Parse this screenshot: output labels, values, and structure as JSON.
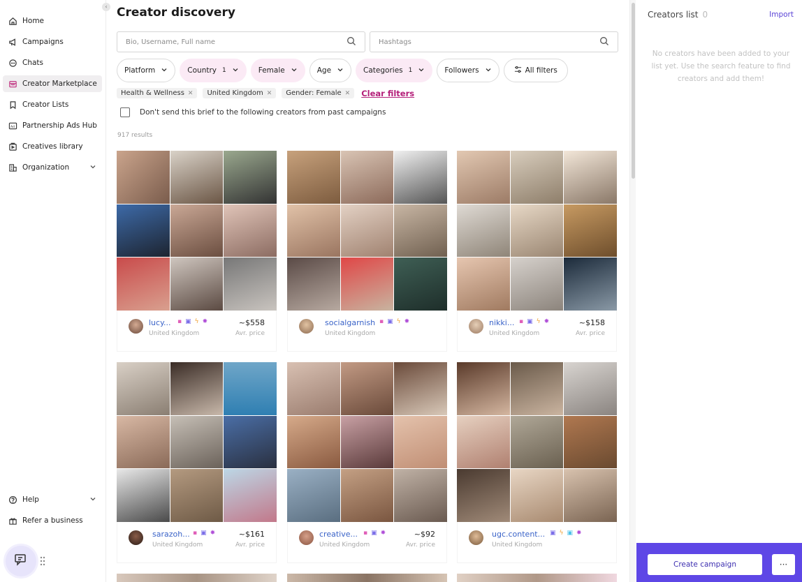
{
  "sidebar": {
    "items": [
      {
        "label": "Home",
        "icon": "home-icon"
      },
      {
        "label": "Campaigns",
        "icon": "megaphone-icon"
      },
      {
        "label": "Chats",
        "icon": "chat-bubble-icon"
      },
      {
        "label": "Creator Marketplace",
        "icon": "marketplace-icon",
        "active": true
      },
      {
        "label": "Creator Lists",
        "icon": "bookmark-icon"
      },
      {
        "label": "Partnership Ads Hub",
        "icon": "ad-icon"
      },
      {
        "label": "Creatives library",
        "icon": "library-icon"
      },
      {
        "label": "Organization",
        "icon": "building-icon",
        "has_chevron": true
      }
    ],
    "bottom": [
      {
        "label": "Help",
        "icon": "help-icon",
        "has_chevron": true
      },
      {
        "label": "Refer a business",
        "icon": "gift-icon"
      }
    ]
  },
  "main": {
    "title": "Creator discovery",
    "search": {
      "placeholder": "Bio, Username, Full name"
    },
    "hashtags": {
      "placeholder": "Hashtags"
    },
    "filters": [
      {
        "label": "Platform",
        "active": false
      },
      {
        "label": "Country",
        "count": "1",
        "active": true
      },
      {
        "label": "Female",
        "active": true
      },
      {
        "label": "Age",
        "active": false
      },
      {
        "label": "Categories",
        "count": "1",
        "active": true
      },
      {
        "label": "Followers",
        "active": false
      }
    ],
    "all_filters": "All filters",
    "chips": [
      "Health & Wellness",
      "United Kingdom",
      "Gender: Female"
    ],
    "clear_filters": "Clear filters",
    "brief_label": "Don't send this brief to the following creators from past campaigns",
    "results": "917 results",
    "price_label": "Avr. price",
    "creators": [
      {
        "name": "lucy...",
        "country": "United Kingdom",
        "price": "~$558"
      },
      {
        "name": "socialgarnish",
        "country": "United Kingdom",
        "price": ""
      },
      {
        "name": "nikki...",
        "country": "United Kingdom",
        "price": "~$158"
      },
      {
        "name": "sarazoh...",
        "country": "United Kingdom",
        "price": "~$161"
      },
      {
        "name": "creative...",
        "country": "United Kingdom",
        "price": "~$92"
      },
      {
        "name": "ugc.content...",
        "country": "United Kingdom",
        "price": ""
      }
    ]
  },
  "right_panel": {
    "title": "Creators list",
    "count": "0",
    "import": "Import",
    "empty_text": "No creators have been added to your list yet. Use the search feature to find creators and add them!",
    "create_campaign": "Create campaign",
    "more": "···"
  },
  "colors": {
    "accent": "#5e47e6",
    "link": "#3a63c8",
    "clear_filters": "#b4207a",
    "active_filter_bg": "#fbeaf5"
  }
}
